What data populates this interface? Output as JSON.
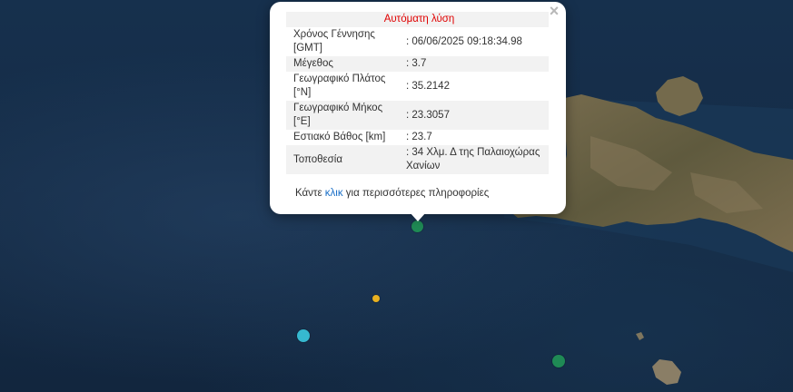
{
  "popup": {
    "title": "Αυτόματη λύση",
    "close_symbol": "×",
    "rows": [
      {
        "label": "Χρόνος Γέννησης [GMT]",
        "value": ": 06/06/2025 09:18:34.98"
      },
      {
        "label": "Μέγεθος",
        "value": ": 3.7"
      },
      {
        "label": "Γεωγραφικό Πλάτος [°N]",
        "value": ": 35.2142"
      },
      {
        "label": "Γεωγραφικό Μήκος [°E]",
        "value": ": 23.3057"
      },
      {
        "label": "Εστιακό Βάθος [km]",
        "value": ": 23.7"
      },
      {
        "label": "Τοποθεσία",
        "value": ": 34 Χλμ. Δ της Παλαιοχώρας Χανίων"
      }
    ],
    "more_prefix": "Κάντε ",
    "more_link": "κλικ",
    "more_suffix": " για περισσότερες πληροφορίες"
  },
  "markers": [
    {
      "name": "selected-earthquake",
      "color": "#1f8a55"
    },
    {
      "name": "earthquake-yellow",
      "color": "#e8b020"
    },
    {
      "name": "earthquake-cyan",
      "color": "#36b8d0"
    },
    {
      "name": "earthquake-green",
      "color": "#1f8a55"
    }
  ],
  "colors": {
    "sea": "#142b45",
    "land": "#6b6248",
    "popup_title": "#e00000",
    "link": "#1a6fc7"
  }
}
